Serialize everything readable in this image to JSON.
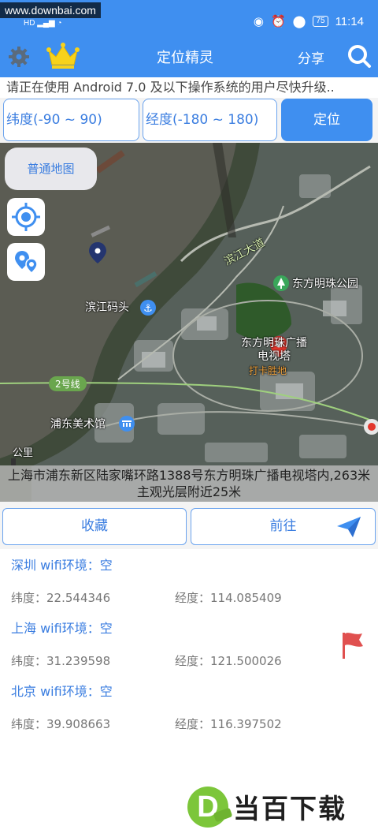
{
  "status_bar": {
    "watermark": "www.downbai.com",
    "left_indicators": "HD",
    "battery": "75",
    "time": "11:14"
  },
  "app_bar": {
    "title": "定位精灵",
    "share_label": "分享"
  },
  "notice": "请正在使用 Android 7.0 及以下操作系统的用户尽快升级..",
  "inputs": {
    "latitude_placeholder": "纬度(-90 ~ 90)",
    "longitude_placeholder": "经度(-180 ~ 180)",
    "locate_label": "定位"
  },
  "map": {
    "map_type_label": "普通地图",
    "labels": {
      "binjiang_road": "滨江大道",
      "park": "东方明珠公园",
      "pier": "滨江码头",
      "tower": "东方明珠广播电视塔",
      "checkin": "打卡胜地",
      "metro": "2号线",
      "museum": "浦东美术馆",
      "distance": "公里"
    },
    "address": "上海市浦东新区陆家嘴环路1388号东方明珠广播电视塔内,263米主观光层附近25米"
  },
  "actions": {
    "favorite_label": "收藏",
    "go_label": "前往"
  },
  "locations": [
    {
      "name": "深圳 wifi环境：空",
      "lat": "纬度：22.544346",
      "lng": "经度：114.085409"
    },
    {
      "name": "上海 wifi环境：空",
      "lat": "纬度：31.239598",
      "lng": "经度：121.500026"
    },
    {
      "name": "北京 wifi环境：空",
      "lat": "纬度：39.908663",
      "lng": "经度：116.397502"
    }
  ],
  "watermark_logo": {
    "letter": "D",
    "text": "当百下载"
  },
  "colors": {
    "primary": "#3f8ff0",
    "text_blue": "#3a7de0",
    "logo_green": "#7cc63a",
    "flag_red": "#e0504f"
  }
}
